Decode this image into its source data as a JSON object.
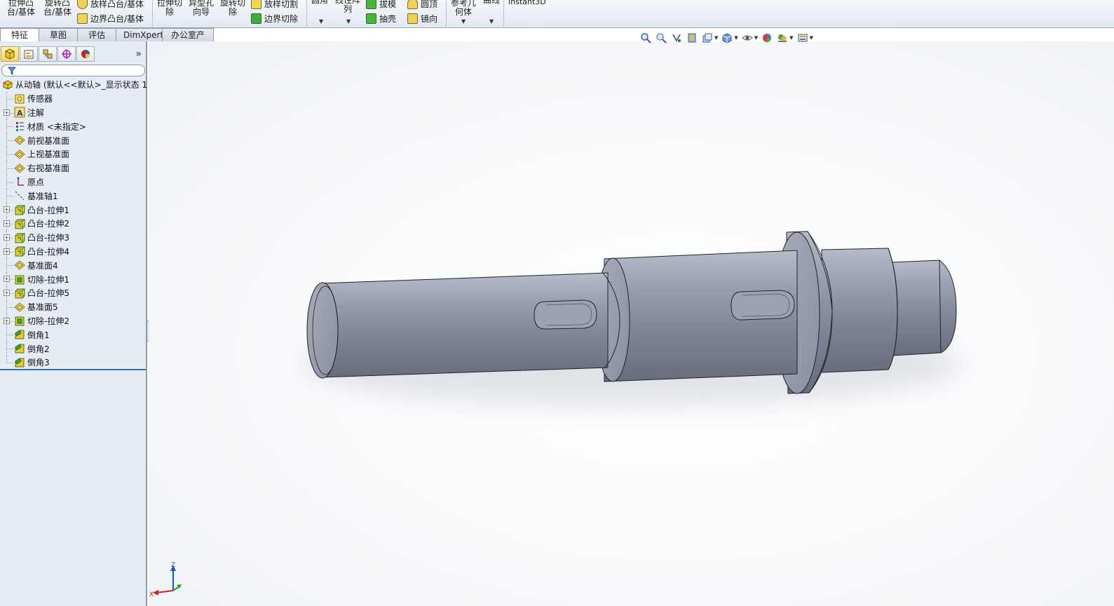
{
  "ribbon": {
    "extrude_boss": "拉伸凸\n台/基体",
    "revolve_boss": "旋转凸\n台/基体",
    "loft_boss": "放样凸台/基体",
    "boundary_boss": "边界凸台/基体",
    "extrude_cut": "拉伸切\n除",
    "hole_wizard": "异型孔\n向导",
    "revolve_cut": "旋转切\n除",
    "loft_cut": "放样切割",
    "boundary_cut": "边界切除",
    "fillet": "圆角",
    "linear_pattern": "线性阵\n列",
    "draft": "拔模",
    "shell": "抽壳",
    "dome": "圆顶",
    "mirror": "镜向",
    "ref_geometry": "参考几\n何体",
    "curves": "曲线",
    "instant3d": "Instant3D"
  },
  "tabs": [
    "特征",
    "草图",
    "评估",
    "DimXpert",
    "办公室产品"
  ],
  "active_tab": "特征",
  "tree": {
    "root": "从动轴 (默认<<默认>_显示状态 1",
    "items": [
      {
        "label": "传感器",
        "icon": "sensor-icon",
        "expandable": false
      },
      {
        "label": "注解",
        "icon": "annotation-icon",
        "expandable": true
      },
      {
        "label": "材质 <未指定>",
        "icon": "material-icon",
        "expandable": false
      },
      {
        "label": "前视基准面",
        "icon": "plane-icon",
        "expandable": false
      },
      {
        "label": "上视基准面",
        "icon": "plane-icon",
        "expandable": false
      },
      {
        "label": "右视基准面",
        "icon": "plane-icon",
        "expandable": false
      },
      {
        "label": "原点",
        "icon": "origin-icon",
        "expandable": false
      },
      {
        "label": "基准轴1",
        "icon": "axis-icon",
        "expandable": false
      },
      {
        "label": "凸台-拉伸1",
        "icon": "extrude-icon",
        "expandable": true
      },
      {
        "label": "凸台-拉伸2",
        "icon": "extrude-icon",
        "expandable": true
      },
      {
        "label": "凸台-拉伸3",
        "icon": "extrude-icon",
        "expandable": true
      },
      {
        "label": "凸台-拉伸4",
        "icon": "extrude-icon",
        "expandable": true
      },
      {
        "label": "基准面4",
        "icon": "plane-icon",
        "expandable": false
      },
      {
        "label": "切除-拉伸1",
        "icon": "cut-icon",
        "expandable": true
      },
      {
        "label": "凸台-拉伸5",
        "icon": "extrude-icon",
        "expandable": true
      },
      {
        "label": "基准面5",
        "icon": "plane-icon",
        "expandable": false
      },
      {
        "label": "切除-拉伸2",
        "icon": "cut-icon",
        "expandable": true
      },
      {
        "label": "倒角1",
        "icon": "chamfer-icon",
        "expandable": false
      },
      {
        "label": "倒角2",
        "icon": "chamfer-icon",
        "expandable": false
      },
      {
        "label": "倒角3",
        "icon": "chamfer-icon",
        "expandable": false
      }
    ]
  },
  "triad": {
    "z": "Z",
    "x": "X"
  },
  "colors": {
    "accent": "#3a6fb3",
    "part": "#8f94a6",
    "panel_bg": "#e6ecf3"
  }
}
